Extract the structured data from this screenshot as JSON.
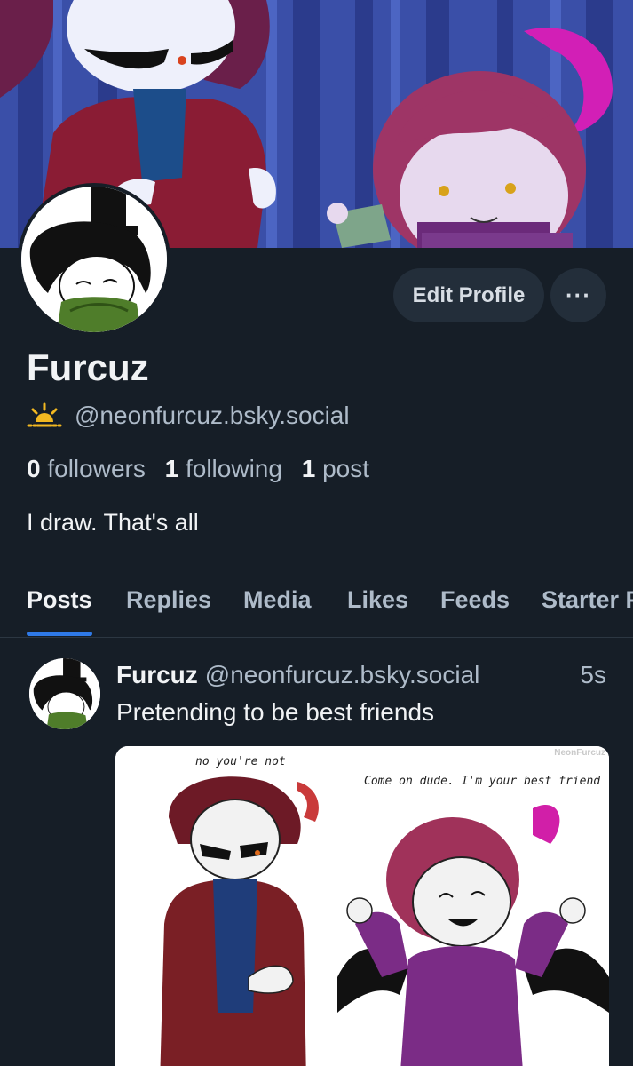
{
  "profile": {
    "display_name": "Furcuz",
    "handle": "@neonfurcuz.bsky.social",
    "bio": "I draw. That's all",
    "edit_label": "Edit Profile",
    "more_label": "···",
    "stats": {
      "followers_count": "0",
      "followers_label": "followers",
      "following_count": "1",
      "following_label": "following",
      "posts_count": "1",
      "posts_label": "post"
    }
  },
  "tabs": [
    {
      "label": "Posts"
    },
    {
      "label": "Replies"
    },
    {
      "label": "Media"
    },
    {
      "label": "Likes"
    },
    {
      "label": "Feeds"
    },
    {
      "label": "Starter Packs"
    }
  ],
  "post": {
    "author": "Furcuz",
    "handle": "@neonfurcuz.bsky.social",
    "time": "5s",
    "text": "Pretending to be best friends",
    "image": {
      "caption_left": "no you're not",
      "caption_right": "Come on dude. I'm your best friend",
      "watermark": "NeonFurcuz"
    }
  },
  "colors": {
    "background": "#161e27",
    "accent": "#2f7ae8",
    "button": "#232e3a",
    "muted_text": "#aebbc9"
  },
  "icons": {
    "handle_icon": "sunrise-icon",
    "more_icon": "ellipsis-icon"
  }
}
